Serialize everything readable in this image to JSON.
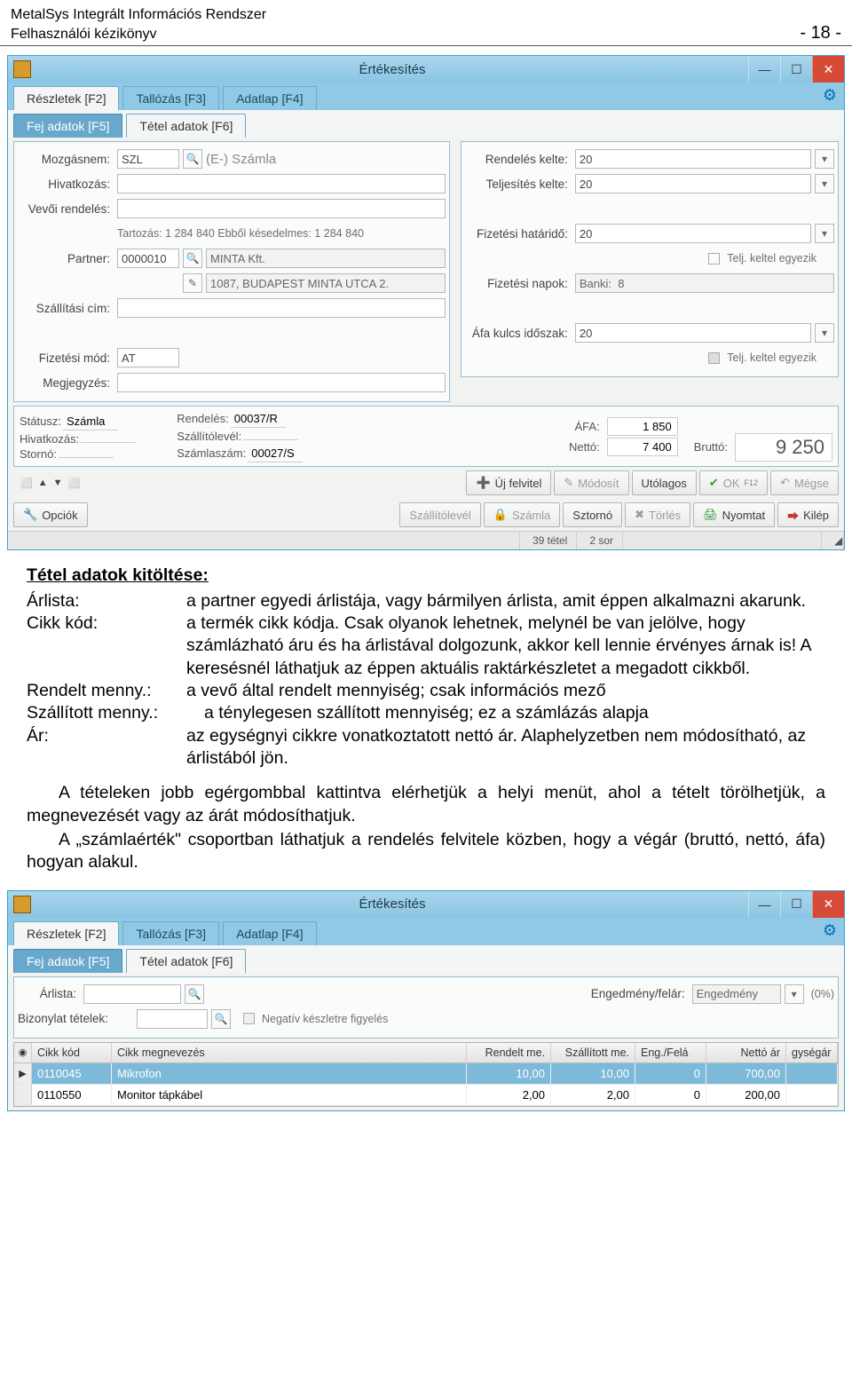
{
  "header": {
    "title": "MetalSys Integrált Információs Rendszer",
    "subtitle": "Felhasználói kézikönyv",
    "page": "- 18 -"
  },
  "win1": {
    "title": "Értékesítés",
    "tabs": {
      "reszletek": "Részletek [F2]",
      "tallozas": "Tallózás [F3]",
      "adatlap": "Adatlap [F4]"
    },
    "subtabs": {
      "fej": "Fej adatok [F5]",
      "tetel": "Tétel adatok [F6]"
    },
    "labels": {
      "mozgasnem": "Mozgásnem:",
      "hivatkozas": "Hivatkozás:",
      "vevoi": "Vevői rendelés:",
      "partner": "Partner:",
      "szallcim": "Szállítási cím:",
      "fizmod": "Fizetési mód:",
      "megj": "Megjegyzés:",
      "rendkelte": "Rendelés kelte:",
      "teljkelte": "Teljesítés kelte:",
      "fizhat": "Fizetési határidő:",
      "fiznap": "Fizetési napok:",
      "afaidoszak": "Áfa kulcs időszak:",
      "teljegy": "Telj. keltel egyezik"
    },
    "vals": {
      "mozgasnem": "SZL",
      "mozgasnem_desc": "(E-) Számla",
      "tartozas": "Tartozás: 1 284 840  Ebből késedelmes: 1 284 840",
      "partner": "0000010",
      "partner_name": "MINTA Kft.",
      "partner_addr": "1087, BUDAPEST MINTA UTCA 2.",
      "fizmod": "AT",
      "rendkelte": "20",
      "teljkelte": "20",
      "fizhat": "20",
      "fiznap": "Banki:  8",
      "afaidoszak": "20"
    },
    "tot": {
      "statusl": "Státusz:",
      "statusv": "Számla",
      "hivl": "Hivatkozás:",
      "stornl": "Stornó:",
      "rendl": "Rendelés:",
      "rendv": "00037/R",
      "szlevl": "Szállítólevél:",
      "szlszl": "Számlaszám:",
      "szlszv": "00027/S",
      "afal": "ÁFA:",
      "afav": "1 850",
      "nettol": "Nettó:",
      "nettov": "7 400",
      "bruttl": "Bruttó:",
      "bruttv": "9 250"
    },
    "btns": {
      "uj": "Új felvitel",
      "mod": "Módosít",
      "utol": "Utólagos",
      "ok": "OK",
      "okF": "F12",
      "megse": "Mégse",
      "opciok": "Opciók",
      "szlev": "Szállítólevél",
      "szamla": "Számla",
      "sztorno": "Sztornó",
      "torles": "Törlés",
      "nyomtat": "Nyomtat",
      "kilep": "Kilép"
    },
    "status": {
      "tetel": "39 tétel",
      "sor": "2 sor"
    }
  },
  "doc": {
    "h": "Tétel adatok kitöltése:",
    "arlista_l": "Árlista:",
    "arlista": "a partner egyedi árlistája, vagy bármilyen árlista, amit éppen alkalmazni akarunk.",
    "cikk_l": "Cikk kód:",
    "cikk": "a termék cikk kódja. Csak olyanok lehetnek, melynél be van jelölve, hogy számlázható áru és ha árlistával dolgozunk, akkor kell lennie érvényes árnak is! A keresésnél láthatjuk az éppen aktuális raktárkészletet a megadott cikkből.",
    "rm_l": "Rendelt menny.:",
    "rm": "a vevő által rendelt mennyiség; csak információs mező",
    "sm_l": "Szállított menny.:",
    "sm": "a ténylegesen szállított mennyiség; ez a számlázás alapja",
    "ar_l": "Ár:",
    "ar": "az egységnyi cikkre vonatkoztatott nettó ár. Alaphelyzetben nem módosítható, az árlistából jön.",
    "p1": "A tételeken jobb egérgombbal kattintva elérhetjük a helyi menüt, ahol a tételt törölhetjük, a megnevezését vagy az árát módosíthatjuk.",
    "p2": "A „számlaérték\" csoportban láthatjuk a rendelés felvitele közben, hogy a végár (bruttó, nettó, áfa) hogyan alakul."
  },
  "win2": {
    "title": "Értékesítés",
    "labels": {
      "arlista": "Árlista:",
      "eng": "Engedmény/felár:",
      "biz": "Bizonylat tételek:",
      "neg": "Negatív készletre figyelés"
    },
    "vals": {
      "eng": "Engedmény",
      "engp": "(0%)"
    },
    "cols": {
      "code": "Cikk kód",
      "name": "Cikk megnevezés",
      "rm": "Rendelt me.",
      "sm": "Szállított me.",
      "ef": "Eng./Felá",
      "price": "Nettó ár",
      "unit": "gységár"
    },
    "rows": [
      {
        "code": "0110045",
        "name": "Mikrofon",
        "rm": "10,00",
        "sm": "10,00",
        "ef": "0",
        "price": "700,00"
      },
      {
        "code": "0110550",
        "name": "Monitor tápkábel",
        "rm": "2,00",
        "sm": "2,00",
        "ef": "0",
        "price": "200,00"
      }
    ]
  }
}
